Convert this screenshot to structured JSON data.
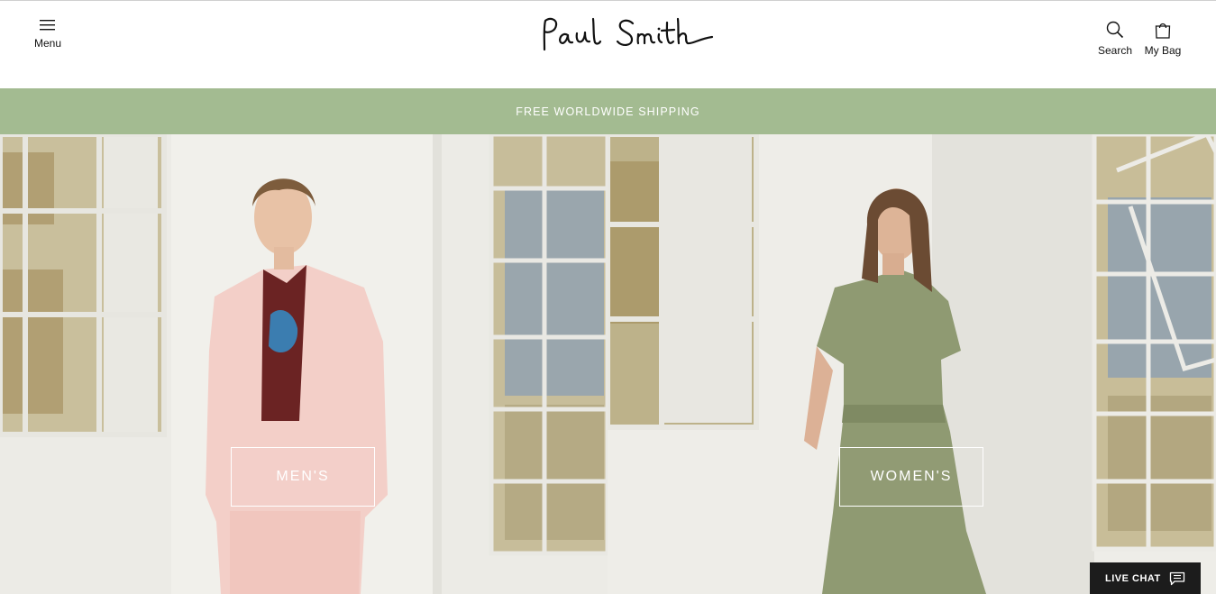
{
  "header": {
    "menu_label": "Menu",
    "brand": "Paul Smith",
    "search_label": "Search",
    "bag_label": "My Bag"
  },
  "promo": {
    "text": "FREE WORLDWIDE SHIPPING",
    "bg_color": "#a3bb91"
  },
  "hero": {
    "men_label": "MEN'S",
    "women_label": "WOMEN'S"
  },
  "chat": {
    "label": "LIVE CHAT"
  },
  "icons": [
    "hamburger-menu-icon",
    "search-icon",
    "shopping-bag-icon",
    "chat-bubble-icon"
  ]
}
